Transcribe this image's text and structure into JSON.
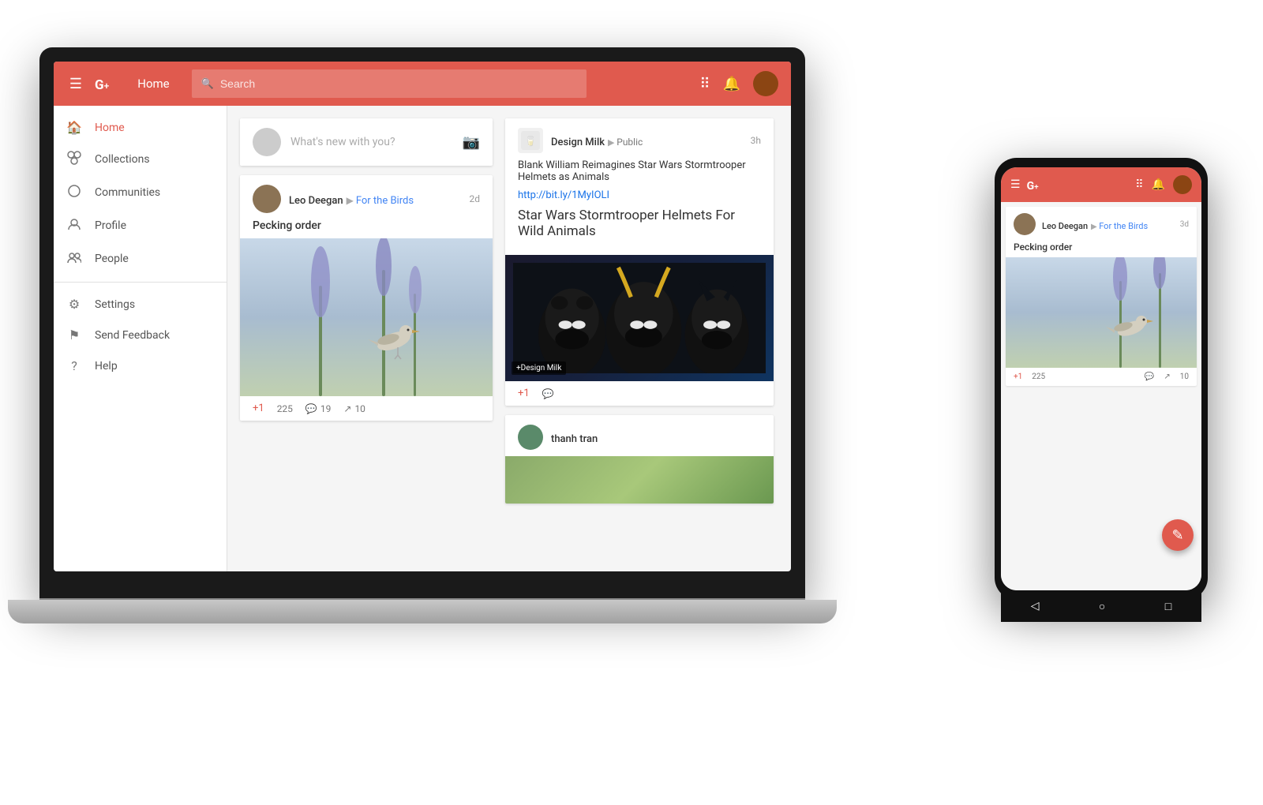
{
  "app": {
    "name": "Google+",
    "logo": "G",
    "plus": "+",
    "accent_color": "#e05a4e"
  },
  "topbar": {
    "home_label": "Home",
    "search_placeholder": "Search",
    "menu_icon": "☰",
    "apps_icon": "⠿",
    "notif_icon": "🔔"
  },
  "sidebar": {
    "items": [
      {
        "id": "home",
        "label": "Home",
        "icon": "⌂",
        "active": true
      },
      {
        "id": "collections",
        "label": "Collections",
        "icon": "◈"
      },
      {
        "id": "communities",
        "label": "Communities",
        "icon": "○"
      },
      {
        "id": "profile",
        "label": "Profile",
        "icon": "◎"
      },
      {
        "id": "people",
        "label": "People",
        "icon": "◉"
      }
    ],
    "bottom_items": [
      {
        "id": "settings",
        "label": "Settings",
        "icon": "⚙"
      },
      {
        "id": "feedback",
        "label": "Send Feedback",
        "icon": "⚑"
      },
      {
        "id": "help",
        "label": "Help",
        "icon": "?"
      }
    ]
  },
  "compose": {
    "placeholder": "What's new with you?"
  },
  "posts": [
    {
      "id": "post1",
      "author": "Leo Deegan",
      "collection": "For the Birds",
      "time": "2d",
      "title": "Pecking order",
      "plus_count": "225",
      "comment_count": "19",
      "share_count": "10"
    },
    {
      "id": "post2",
      "author": "Design Milk",
      "audience": "Public",
      "time": "3h",
      "headline": "Blank William Reimagines Star Wars Stormtrooper Helmets as Animals",
      "link": "http://bit.ly/1MyIOLI",
      "title": "Star Wars Stormtrooper Helmets For Wild Animals",
      "badge": "+Design Milk",
      "plus_count": "",
      "comment_icon": "💬"
    },
    {
      "id": "post3",
      "author": "thanh tran"
    }
  ],
  "phone": {
    "post": {
      "author": "Leo Deegan",
      "collection": "For the Birds",
      "time": "3d",
      "title": "Pecking order",
      "plus_label": "+1",
      "plus_count": "225",
      "comment_count": "",
      "share_count": "10",
      "fab_icon": "✎"
    },
    "nav": {
      "back": "◁",
      "home": "○",
      "square": "□"
    }
  }
}
